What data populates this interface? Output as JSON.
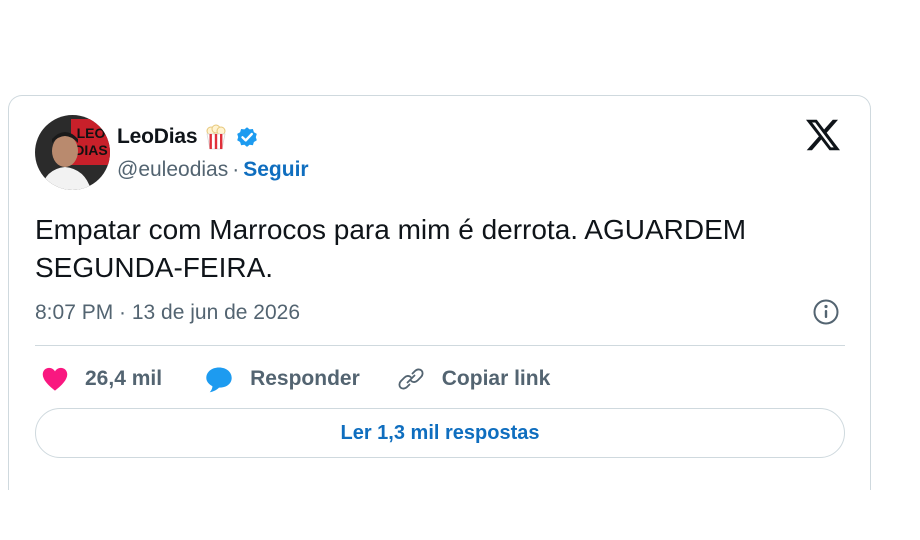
{
  "tweet": {
    "author_name": "LeoDias",
    "handle": "@euleodias",
    "separator": "·",
    "follow_label": "Seguir",
    "text": "Empatar com Marrocos para mim é derrota. AGUARDEM SEGUNDA-FEIRA.",
    "timestamp": "8:07 PM · 13 de jun de 2026",
    "avatar_text": "LEO DIAS"
  },
  "actions": {
    "likes": "26,4 mil",
    "reply_label": "Responder",
    "copy_link_label": "Copiar link"
  },
  "read_replies_label": "Ler 1,3 mil respostas",
  "colors": {
    "like": "#f91880",
    "reply": "#1d9bf0",
    "link_blue": "#0f6ebf",
    "verified": "#1d9bf0",
    "border": "#cfd9de"
  },
  "icons": [
    "popcorn-icon",
    "verified-badge-icon",
    "x-logo-icon",
    "info-icon",
    "heart-icon",
    "reply-bubble-icon",
    "link-icon"
  ]
}
